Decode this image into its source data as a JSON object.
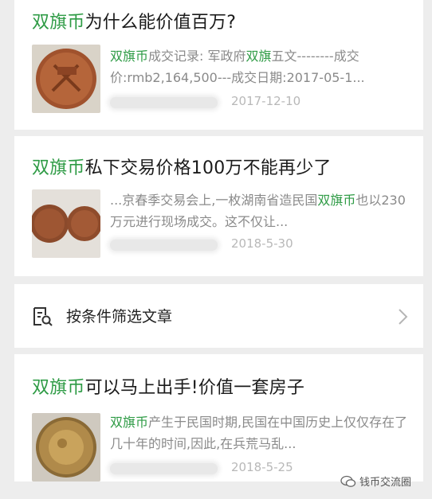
{
  "colors": {
    "highlight": "#2e9b45",
    "background": "#ededed",
    "card": "#ffffff",
    "date": "#b8b8b8"
  },
  "articles": [
    {
      "title_hl": "双旗币",
      "title_rest": "为什么能价值百万?",
      "snippet": [
        {
          "t": "双旗币",
          "hl": true
        },
        {
          "t": "成交记录: 军政府",
          "hl": false
        },
        {
          "t": "双旗",
          "hl": true
        },
        {
          "t": "五文--------成交价:rmb2,164,500---成交日期:2017-05-1...",
          "hl": false
        }
      ],
      "date": "2017-12-10"
    },
    {
      "title_hl": "双旗币",
      "title_rest": "私下交易价格100万不能再少了",
      "snippet": [
        {
          "t": "...京春季交易会上,一枚湖南省造民国",
          "hl": false
        },
        {
          "t": "双旗币",
          "hl": true
        },
        {
          "t": "也以230万元进行现场成交。这不仅让...",
          "hl": false
        }
      ],
      "date": "2018-5-30"
    },
    {
      "title_hl": "双旗币",
      "title_rest": "可以马上出手!价值一套房子",
      "snippet": [
        {
          "t": "双旗币",
          "hl": true
        },
        {
          "t": "产生于民国时期,民国在中国历史上仅仅存在了几十年的时间,因此,在兵荒马乱...",
          "hl": false
        }
      ],
      "date": "2018-5-25"
    }
  ],
  "filter": {
    "label": "按条件筛选文章",
    "icon": "filter-doc-icon",
    "chevron": "chevron-right-icon"
  },
  "watermark": {
    "text": "钱币交流圈",
    "icon": "wechat-icon"
  }
}
